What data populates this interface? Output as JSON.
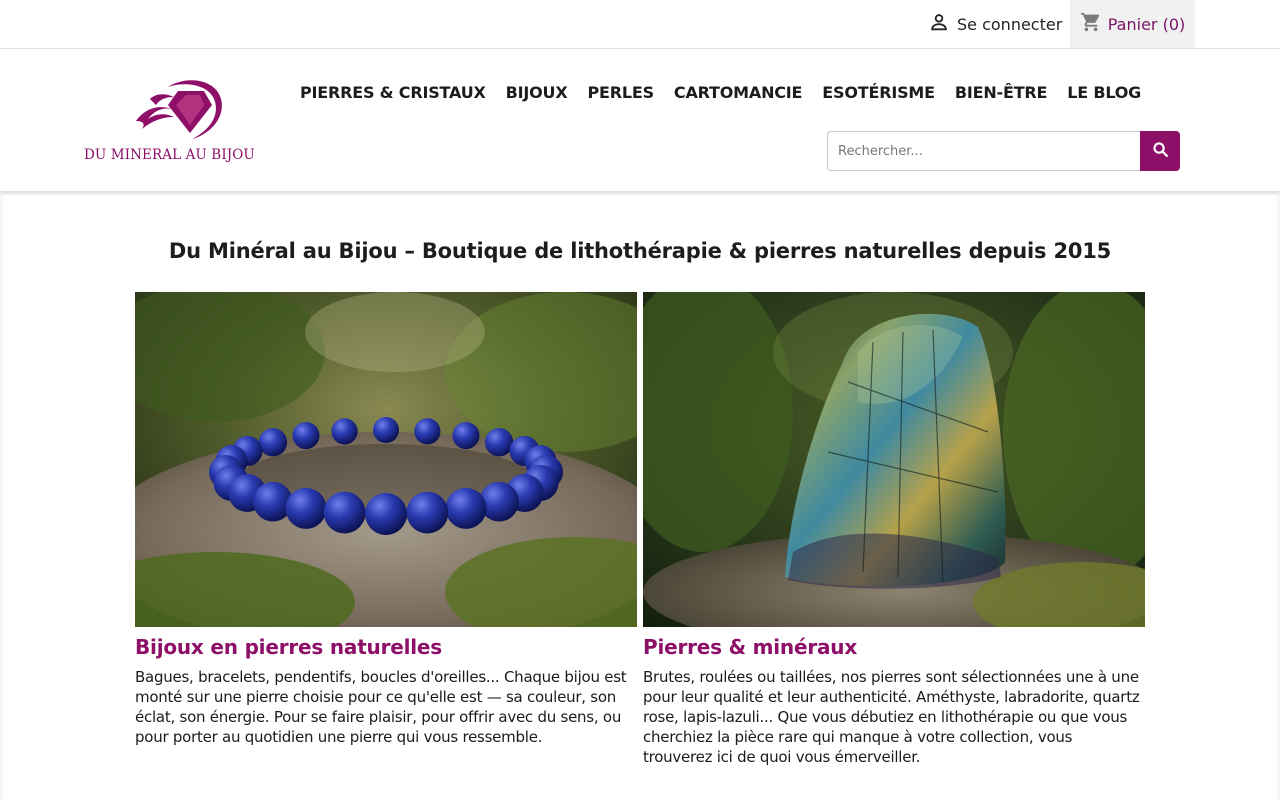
{
  "topbar": {
    "login_label": "Se connecter",
    "cart_label": "Panier (0)",
    "login_icon": "user-icon",
    "cart_icon": "shopping-cart-icon"
  },
  "header": {
    "logo_text": "DU MINERAL AU BIJOU",
    "nav": [
      {
        "label": "PIERRES & CRISTAUX"
      },
      {
        "label": "BIJOUX"
      },
      {
        "label": "PERLES"
      },
      {
        "label": "CARTOMANCIE"
      },
      {
        "label": "ESOTÉRISME"
      },
      {
        "label": "BIEN-ÊTRE"
      },
      {
        "label": "LE BLOG"
      }
    ],
    "search": {
      "placeholder": "Rechercher...",
      "value": "",
      "icon": "search-icon"
    }
  },
  "main": {
    "title": "Du Minéral au Bijou – Boutique de lithothérapie & pierres naturelles depuis 2015",
    "cards": [
      {
        "title": "Bijoux en pierres naturelles",
        "text": "Bagues, bracelets, pendentifs, boucles d'oreilles... Chaque bijou est monté sur une pierre choisie pour ce qu'elle est — sa couleur, son éclat, son énergie. Pour se faire plaisir, pour offrir avec du sens, ou pour porter au quotidien une pierre qui vous ressemble."
      },
      {
        "title": "Pierres & minéraux",
        "text": "Brutes, roulées ou taillées, nos pierres sont sélectionnées une à une pour leur qualité et leur authenticité. Améthyste, labradorite, quartz rose, lapis-lazuli... Que vous débutiez en lithothérapie ou que vous cherchiez la pièce rare qui manque à votre collection, vous trouverez ici de quoi vous émerveiller."
      }
    ]
  },
  "colors": {
    "brand": "#8d0f68",
    "text": "#1b1b1b",
    "topbar_cart_bg": "#f1f1f1"
  }
}
